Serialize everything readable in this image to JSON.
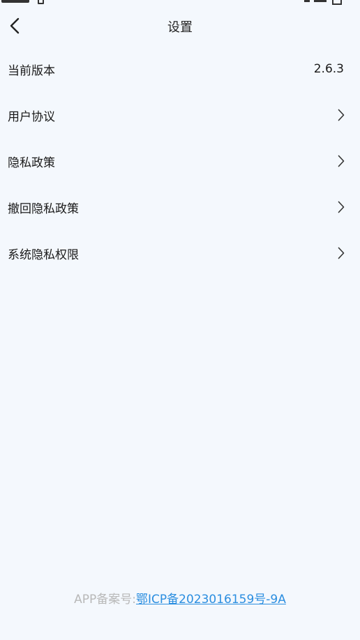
{
  "header": {
    "title": "设置",
    "back_icon": "chevron-left-icon"
  },
  "settings": {
    "items": [
      {
        "id": "version",
        "label": "当前版本",
        "value": "2.6.3",
        "has_chevron": false
      },
      {
        "id": "user-agreement",
        "label": "用户协议",
        "has_chevron": true
      },
      {
        "id": "privacy-policy",
        "label": "隐私政策",
        "has_chevron": true
      },
      {
        "id": "withdraw-privacy",
        "label": "撤回隐私政策",
        "has_chevron": true
      },
      {
        "id": "system-permissions",
        "label": "系统隐私权限",
        "has_chevron": true
      }
    ]
  },
  "footer": {
    "label": "APP备案号:",
    "link_text": "鄂ICP备2023016159号-9A"
  },
  "colors": {
    "background": "#f4f8fd",
    "text": "#1a1a1a",
    "footer_label": "#b8b8b8",
    "link": "#2b8ee0"
  }
}
